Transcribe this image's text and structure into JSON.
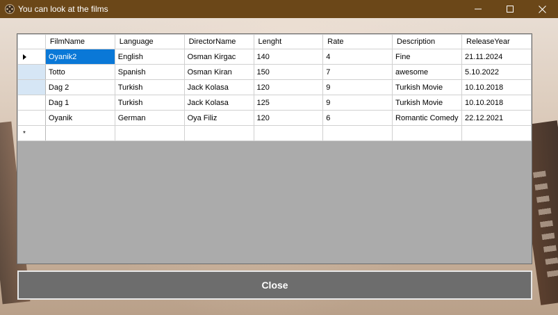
{
  "window": {
    "title": "You can look at the films",
    "icon": "film-reel-icon"
  },
  "grid": {
    "columns": [
      "FilmName",
      "Language",
      "DirectorName",
      "Lenght",
      "Rate",
      "Description",
      "ReleaseYear"
    ],
    "rows": [
      [
        "Oyanik2",
        "English",
        "Osman Kirgac",
        "140",
        "4",
        "Fine",
        "21.11.2024"
      ],
      [
        "Totto",
        "Spanish",
        "Osman Kiran",
        "150",
        "7",
        "awesome",
        "5.10.2022"
      ],
      [
        "Dag 2",
        "Turkish",
        "Jack Kolasa",
        "120",
        "9",
        "Turkish Movie",
        "10.10.2018"
      ],
      [
        "Dag 1",
        "Turkish",
        "Jack Kolasa",
        "125",
        "9",
        "Turkish Movie",
        "10.10.2018"
      ],
      [
        "Oyanik",
        "German",
        "Oya Filiz",
        "120",
        "6",
        "Romantic Comedy",
        "22.12.2021"
      ]
    ],
    "new_row_marker": "*",
    "selected_cell_color": "#0a78d7",
    "background_color": "#ababab"
  },
  "buttons": {
    "close_label": "Close"
  },
  "colors": {
    "titlebar": "#6b4718",
    "close_button": "#6d6d6d"
  }
}
